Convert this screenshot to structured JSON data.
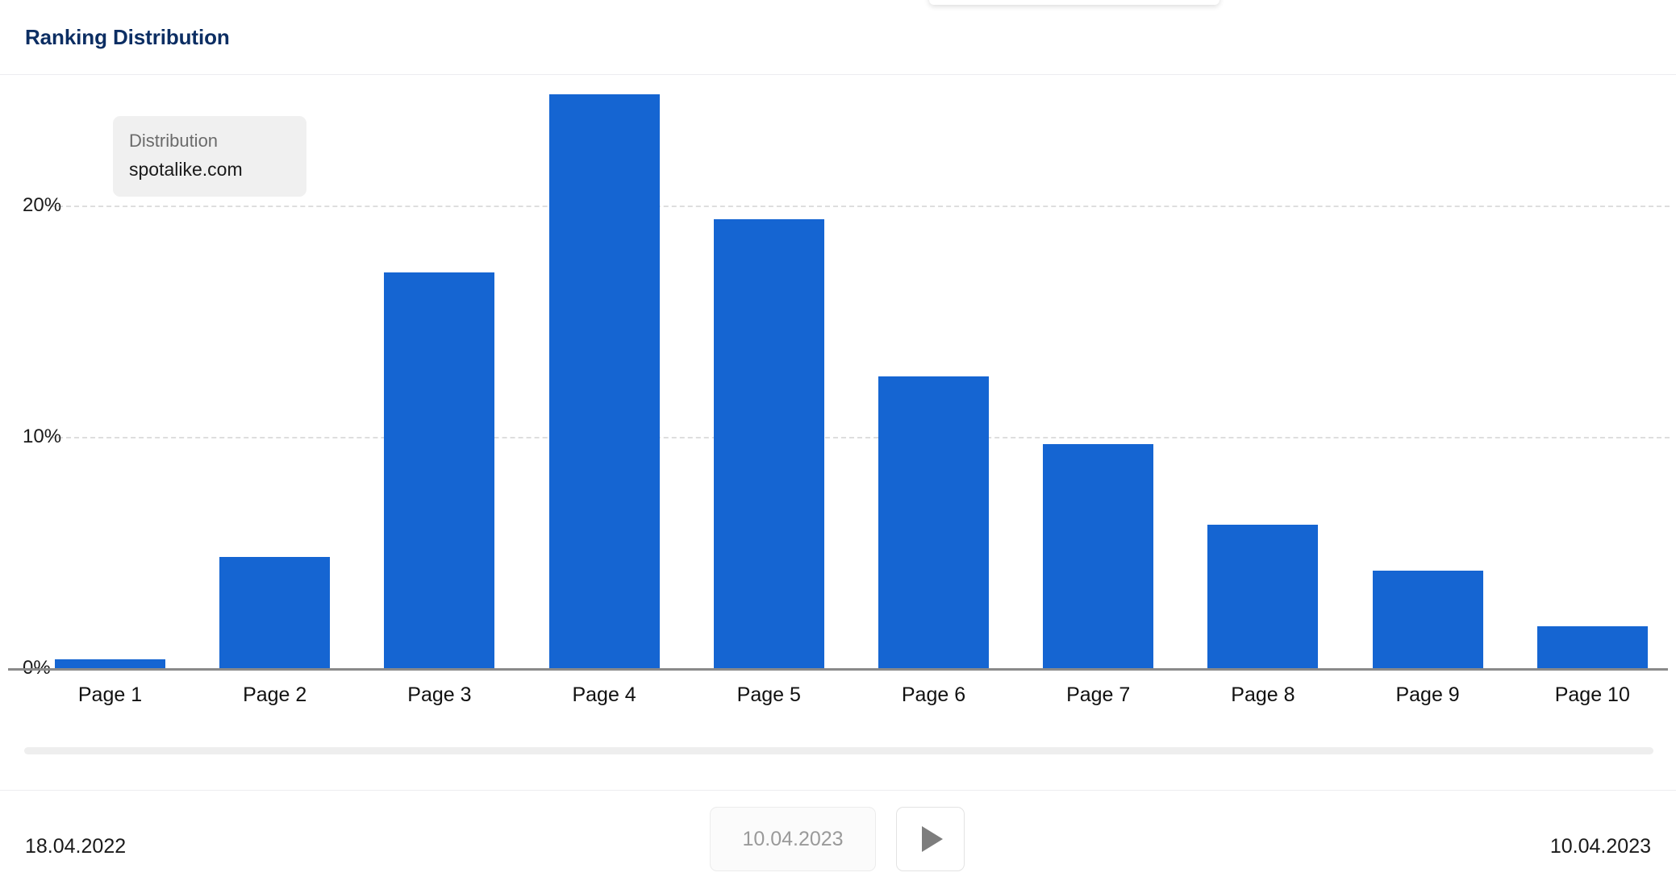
{
  "header": {
    "title": "Ranking Distribution"
  },
  "tooltip": {
    "label": "Distribution",
    "value": "spotalike.com"
  },
  "footer": {
    "start_date": "18.04.2022",
    "end_date": "10.04.2023",
    "date_input_value": "10.04.2023",
    "play_icon": "play-triangle-icon"
  },
  "colors": {
    "bar": "#1565d2",
    "title": "#0c2e63",
    "gridline": "#dedede",
    "baseline": "#8a8a8a",
    "tooltip_bg": "#f0f0f0"
  },
  "chart_data": {
    "type": "bar",
    "title": "Ranking Distribution",
    "xlabel": "",
    "ylabel": "",
    "categories": [
      "Page 1",
      "Page 2",
      "Page 3",
      "Page 4",
      "Page 5",
      "Page 6",
      "Page 7",
      "Page 8",
      "Page 9",
      "Page 10"
    ],
    "values": [
      0.4,
      4.8,
      17.1,
      24.8,
      19.4,
      12.6,
      9.7,
      6.2,
      4.2,
      1.8
    ],
    "value_unit": "%",
    "ylim": [
      0,
      25.5
    ],
    "yticks": [
      0,
      10,
      20
    ],
    "ytick_labels": [
      "0%",
      "10%",
      "20%"
    ],
    "grid": true,
    "legend": false,
    "series": [
      {
        "name": "spotalike.com",
        "values": [
          0.4,
          4.8,
          17.1,
          24.8,
          19.4,
          12.6,
          9.7,
          6.2,
          4.2,
          1.8
        ]
      }
    ],
    "annotations": [
      {
        "type": "tooltip",
        "label": "Distribution",
        "value": "spotalike.com"
      }
    ]
  }
}
